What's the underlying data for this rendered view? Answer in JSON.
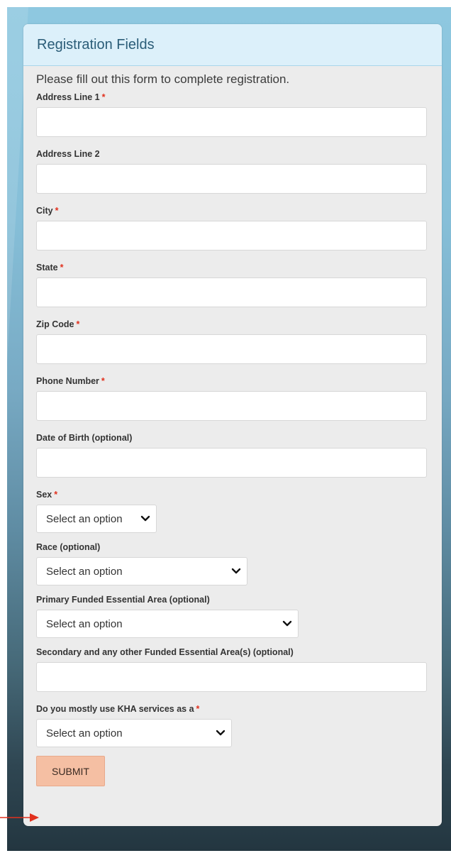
{
  "card": {
    "title": "Registration Fields",
    "intro": "Please fill out this form to complete registration."
  },
  "fields": [
    {
      "label": "Address Line 1",
      "required": "*"
    },
    {
      "label": "Address Line 2"
    },
    {
      "label": "City",
      "required": "*"
    },
    {
      "label": "State",
      "required": "*"
    },
    {
      "label": "Zip Code",
      "required": "*"
    },
    {
      "label": "Phone Number",
      "required": "*"
    },
    {
      "label": "Date of Birth (optional)"
    },
    {
      "label": "Sex",
      "required": "*",
      "value": "Select an option"
    },
    {
      "label": "Race (optional)",
      "value": "Select an option"
    },
    {
      "label": "Primary Funded Essential Area (optional)",
      "value": "Select an option"
    },
    {
      "label": "Secondary and any other Funded Essential Area(s) (optional)"
    },
    {
      "label": "Do you mostly use KHA services as a",
      "required": "*",
      "value": "Select an option"
    }
  ],
  "submit_label": "SUBMIT",
  "colors": {
    "accent": "#f5bfa3",
    "required": "#e1311e",
    "arrow": "#e1311e"
  },
  "icons": {
    "select": "chevron-down-icon",
    "pointer": "red-arrow-icon"
  }
}
